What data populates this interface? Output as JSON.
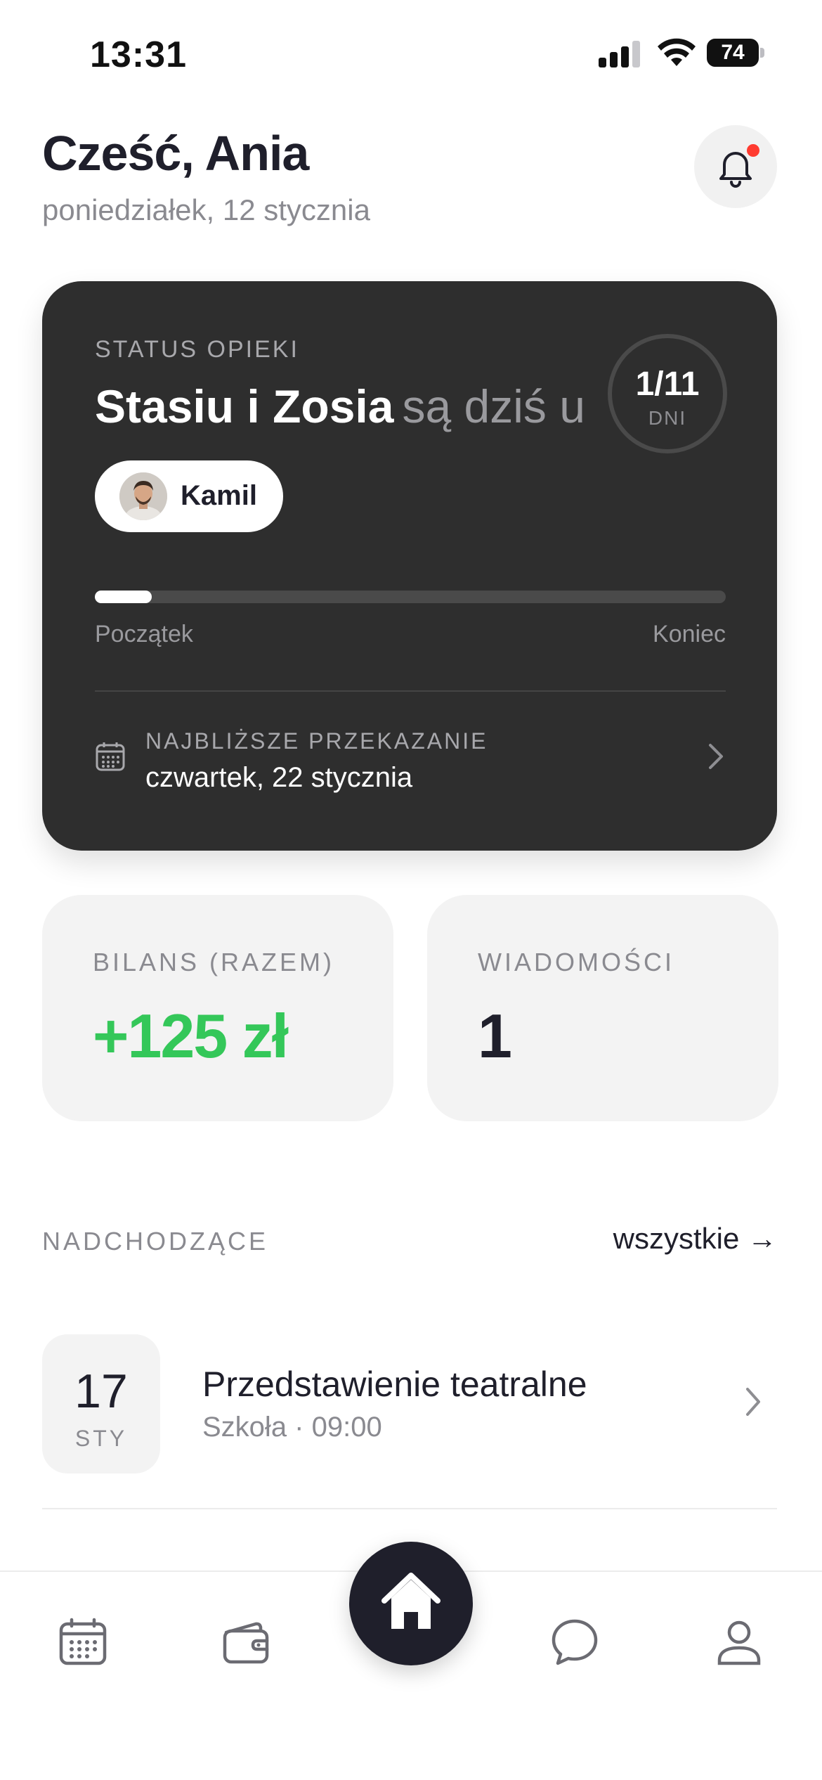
{
  "status_bar": {
    "time": "13:31",
    "battery": "74"
  },
  "header": {
    "greeting": "Cześć, Ania",
    "date": "poniedziałek, 12 stycznia",
    "notification_badge_color": "#ff3b30"
  },
  "custody_card": {
    "label": "STATUS OPIEKI",
    "children": "Stasiu i Zosia",
    "title_rest": "są dziś u",
    "parent_name": "Kamil",
    "days_value": "1/11",
    "days_unit": "DNI",
    "progress_fraction": 0.09,
    "progress_start": "Początek",
    "progress_end": "Koniec",
    "handover_label": "NAJBLIŻSZE PRZEKAZANIE",
    "handover_date": "czwartek, 22 stycznia"
  },
  "stats": {
    "balance_label": "BILANS (RAZEM)",
    "balance_value": "+125 zł",
    "balance_color": "#34c759",
    "messages_label": "WIADOMOŚCI",
    "messages_value": "1"
  },
  "upcoming": {
    "label": "NADCHODZĄCE",
    "see_all": "wszystkie →",
    "events": [
      {
        "day": "17",
        "month": "STY",
        "title": "Przedstawienie teatralne",
        "subtitle": "Szkoła · 09:00"
      }
    ]
  },
  "tab_bar": {
    "tabs": [
      {
        "icon": "calendar-icon"
      },
      {
        "icon": "wallet-icon"
      },
      {
        "icon": "home-icon",
        "active": true
      },
      {
        "icon": "chat-icon"
      },
      {
        "icon": "profile-icon"
      }
    ]
  }
}
